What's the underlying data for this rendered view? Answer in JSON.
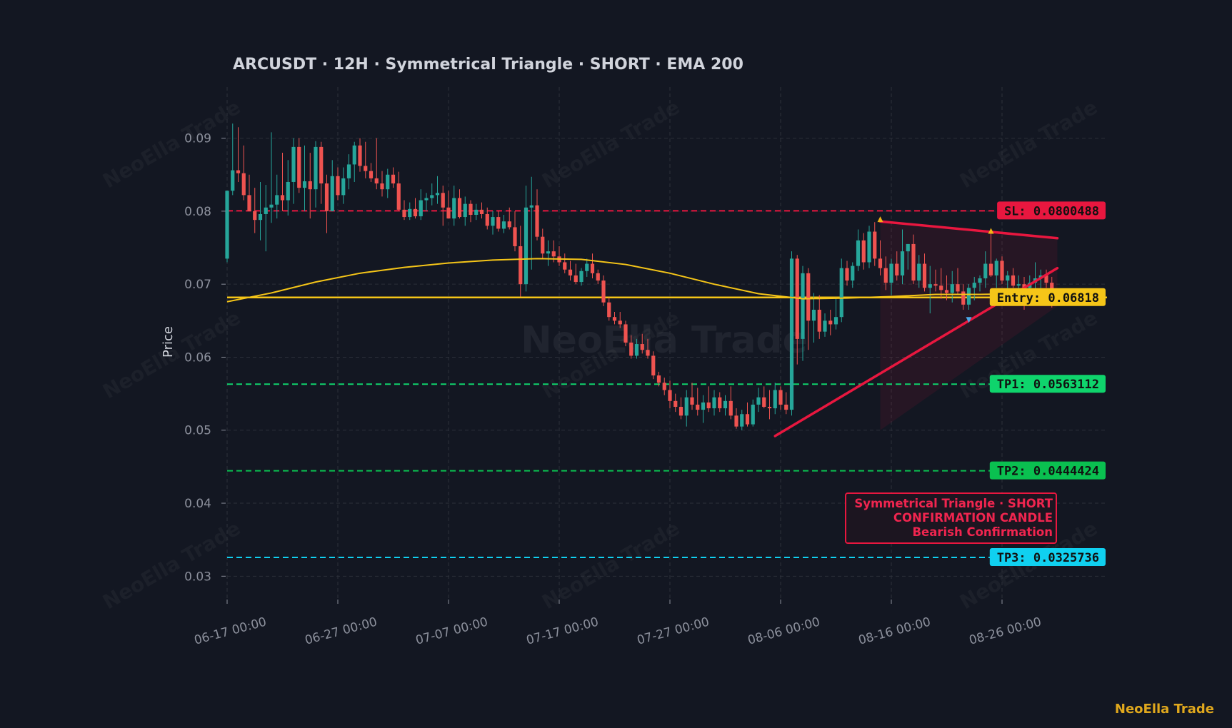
{
  "chart_data": {
    "type": "candlestick",
    "title": "ARCUSDT  ·  12H  ·  Symmetrical Triangle  ·  SHORT  ·  EMA 200",
    "ylabel": "Price",
    "xlabel": "",
    "ylim": [
      0.027,
      0.097
    ],
    "yticks": [
      "0.03",
      "0.04",
      "0.05",
      "0.06",
      "0.07",
      "0.08",
      "0.09"
    ],
    "ytick_values": [
      0.03,
      0.04,
      0.05,
      0.06,
      0.07,
      0.08,
      0.09
    ],
    "xticks": [
      "06-17 00:00",
      "06-27 00:00",
      "07-07 00:00",
      "07-17 00:00",
      "07-27 00:00",
      "08-06 00:00",
      "08-16 00:00",
      "08-26 00:00"
    ],
    "grid": true,
    "colors": {
      "up": "#26a69a",
      "down": "#ef5350",
      "ema": "#f5c518",
      "sl": "#e8173f",
      "entry": "#f5c518",
      "tp1": "#0fd46c",
      "tp2": "#0ac050",
      "tp3": "#10d0f0",
      "background": "#131722"
    },
    "ohlc": [
      {
        "o": 0.0735,
        "h": 0.0828,
        "l": 0.073,
        "c": 0.0828
      },
      {
        "o": 0.0828,
        "h": 0.092,
        "l": 0.0822,
        "c": 0.0856
      },
      {
        "o": 0.0856,
        "h": 0.0915,
        "l": 0.084,
        "c": 0.0852
      },
      {
        "o": 0.0852,
        "h": 0.089,
        "l": 0.0815,
        "c": 0.0822
      },
      {
        "o": 0.0822,
        "h": 0.085,
        "l": 0.08,
        "c": 0.08
      },
      {
        "o": 0.08,
        "h": 0.0832,
        "l": 0.077,
        "c": 0.0788
      },
      {
        "o": 0.0788,
        "h": 0.084,
        "l": 0.076,
        "c": 0.0796
      },
      {
        "o": 0.0796,
        "h": 0.0836,
        "l": 0.0745,
        "c": 0.0805
      },
      {
        "o": 0.0805,
        "h": 0.0908,
        "l": 0.0784,
        "c": 0.0809
      },
      {
        "o": 0.0809,
        "h": 0.085,
        "l": 0.079,
        "c": 0.0822
      },
      {
        "o": 0.0822,
        "h": 0.088,
        "l": 0.08,
        "c": 0.0815
      },
      {
        "o": 0.0815,
        "h": 0.087,
        "l": 0.0794,
        "c": 0.084
      },
      {
        "o": 0.084,
        "h": 0.09,
        "l": 0.081,
        "c": 0.0888
      },
      {
        "o": 0.0888,
        "h": 0.09,
        "l": 0.0825,
        "c": 0.0832
      },
      {
        "o": 0.0832,
        "h": 0.089,
        "l": 0.08,
        "c": 0.0841
      },
      {
        "o": 0.0841,
        "h": 0.088,
        "l": 0.079,
        "c": 0.083
      },
      {
        "o": 0.083,
        "h": 0.0896,
        "l": 0.0805,
        "c": 0.0888
      },
      {
        "o": 0.0888,
        "h": 0.0895,
        "l": 0.081,
        "c": 0.0838
      },
      {
        "o": 0.0838,
        "h": 0.085,
        "l": 0.077,
        "c": 0.08
      },
      {
        "o": 0.08,
        "h": 0.087,
        "l": 0.08,
        "c": 0.0848
      },
      {
        "o": 0.0848,
        "h": 0.086,
        "l": 0.0815,
        "c": 0.0822
      },
      {
        "o": 0.0822,
        "h": 0.086,
        "l": 0.081,
        "c": 0.0845
      },
      {
        "o": 0.0845,
        "h": 0.0878,
        "l": 0.083,
        "c": 0.0864
      },
      {
        "o": 0.0864,
        "h": 0.0895,
        "l": 0.084,
        "c": 0.089
      },
      {
        "o": 0.089,
        "h": 0.09,
        "l": 0.0854,
        "c": 0.0862
      },
      {
        "o": 0.0862,
        "h": 0.0895,
        "l": 0.0845,
        "c": 0.0855
      },
      {
        "o": 0.0855,
        "h": 0.0866,
        "l": 0.084,
        "c": 0.0845
      },
      {
        "o": 0.0845,
        "h": 0.09,
        "l": 0.083,
        "c": 0.0838
      },
      {
        "o": 0.0838,
        "h": 0.0855,
        "l": 0.082,
        "c": 0.083
      },
      {
        "o": 0.083,
        "h": 0.0858,
        "l": 0.0818,
        "c": 0.085
      },
      {
        "o": 0.085,
        "h": 0.086,
        "l": 0.0832,
        "c": 0.0838
      },
      {
        "o": 0.0838,
        "h": 0.0854,
        "l": 0.08,
        "c": 0.0802
      },
      {
        "o": 0.0802,
        "h": 0.0815,
        "l": 0.0788,
        "c": 0.0792
      },
      {
        "o": 0.0792,
        "h": 0.0812,
        "l": 0.0788,
        "c": 0.0803
      },
      {
        "o": 0.0803,
        "h": 0.0818,
        "l": 0.079,
        "c": 0.0793
      },
      {
        "o": 0.0793,
        "h": 0.083,
        "l": 0.0788,
        "c": 0.0815
      },
      {
        "o": 0.0815,
        "h": 0.0825,
        "l": 0.08,
        "c": 0.0818
      },
      {
        "o": 0.0818,
        "h": 0.0838,
        "l": 0.0808,
        "c": 0.0822
      },
      {
        "o": 0.0822,
        "h": 0.0848,
        "l": 0.081,
        "c": 0.0825
      },
      {
        "o": 0.0825,
        "h": 0.0835,
        "l": 0.078,
        "c": 0.0805
      },
      {
        "o": 0.0805,
        "h": 0.0828,
        "l": 0.079,
        "c": 0.079
      },
      {
        "o": 0.079,
        "h": 0.0835,
        "l": 0.078,
        "c": 0.0818
      },
      {
        "o": 0.0818,
        "h": 0.083,
        "l": 0.079,
        "c": 0.0792
      },
      {
        "o": 0.0792,
        "h": 0.082,
        "l": 0.078,
        "c": 0.081
      },
      {
        "o": 0.081,
        "h": 0.0815,
        "l": 0.0785,
        "c": 0.0795
      },
      {
        "o": 0.0795,
        "h": 0.081,
        "l": 0.0788,
        "c": 0.0802
      },
      {
        "o": 0.0802,
        "h": 0.0812,
        "l": 0.079,
        "c": 0.0796
      },
      {
        "o": 0.0796,
        "h": 0.0805,
        "l": 0.0775,
        "c": 0.078
      },
      {
        "o": 0.078,
        "h": 0.08,
        "l": 0.0768,
        "c": 0.0792
      },
      {
        "o": 0.0792,
        "h": 0.08,
        "l": 0.0772,
        "c": 0.0776
      },
      {
        "o": 0.0776,
        "h": 0.0795,
        "l": 0.077,
        "c": 0.0786
      },
      {
        "o": 0.0786,
        "h": 0.0805,
        "l": 0.0775,
        "c": 0.0778
      },
      {
        "o": 0.0778,
        "h": 0.08,
        "l": 0.0745,
        "c": 0.0752
      },
      {
        "o": 0.0752,
        "h": 0.078,
        "l": 0.0683,
        "c": 0.07
      },
      {
        "o": 0.07,
        "h": 0.0835,
        "l": 0.069,
        "c": 0.0805
      },
      {
        "o": 0.0805,
        "h": 0.0847,
        "l": 0.072,
        "c": 0.0808
      },
      {
        "o": 0.0808,
        "h": 0.083,
        "l": 0.076,
        "c": 0.0765
      },
      {
        "o": 0.0765,
        "h": 0.0776,
        "l": 0.0735,
        "c": 0.0742
      },
      {
        "o": 0.0742,
        "h": 0.076,
        "l": 0.0725,
        "c": 0.0745
      },
      {
        "o": 0.0745,
        "h": 0.076,
        "l": 0.073,
        "c": 0.0738
      },
      {
        "o": 0.0738,
        "h": 0.0752,
        "l": 0.0725,
        "c": 0.073
      },
      {
        "o": 0.073,
        "h": 0.0742,
        "l": 0.0715,
        "c": 0.072
      },
      {
        "o": 0.072,
        "h": 0.0732,
        "l": 0.0705,
        "c": 0.0712
      },
      {
        "o": 0.0712,
        "h": 0.0728,
        "l": 0.07,
        "c": 0.0703
      },
      {
        "o": 0.0703,
        "h": 0.0722,
        "l": 0.0698,
        "c": 0.0718
      },
      {
        "o": 0.0718,
        "h": 0.0735,
        "l": 0.071,
        "c": 0.0728
      },
      {
        "o": 0.0728,
        "h": 0.0742,
        "l": 0.0708,
        "c": 0.0715
      },
      {
        "o": 0.0715,
        "h": 0.072,
        "l": 0.07,
        "c": 0.0705
      },
      {
        "o": 0.0705,
        "h": 0.0712,
        "l": 0.067,
        "c": 0.0675
      },
      {
        "o": 0.0675,
        "h": 0.0682,
        "l": 0.065,
        "c": 0.0655
      },
      {
        "o": 0.0655,
        "h": 0.0662,
        "l": 0.0645,
        "c": 0.065
      },
      {
        "o": 0.065,
        "h": 0.0662,
        "l": 0.064,
        "c": 0.0645
      },
      {
        "o": 0.0645,
        "h": 0.065,
        "l": 0.0615,
        "c": 0.062
      },
      {
        "o": 0.062,
        "h": 0.063,
        "l": 0.0598,
        "c": 0.0602
      },
      {
        "o": 0.0602,
        "h": 0.0625,
        "l": 0.0598,
        "c": 0.0618
      },
      {
        "o": 0.0618,
        "h": 0.0632,
        "l": 0.0605,
        "c": 0.061
      },
      {
        "o": 0.061,
        "h": 0.0625,
        "l": 0.0598,
        "c": 0.0602
      },
      {
        "o": 0.0602,
        "h": 0.0608,
        "l": 0.057,
        "c": 0.0575
      },
      {
        "o": 0.0575,
        "h": 0.058,
        "l": 0.056,
        "c": 0.0565
      },
      {
        "o": 0.0565,
        "h": 0.0572,
        "l": 0.0548,
        "c": 0.0555
      },
      {
        "o": 0.0555,
        "h": 0.0568,
        "l": 0.053,
        "c": 0.054
      },
      {
        "o": 0.054,
        "h": 0.055,
        "l": 0.0525,
        "c": 0.0532
      },
      {
        "o": 0.0532,
        "h": 0.0545,
        "l": 0.0515,
        "c": 0.052
      },
      {
        "o": 0.052,
        "h": 0.0555,
        "l": 0.0505,
        "c": 0.0545
      },
      {
        "o": 0.0545,
        "h": 0.0565,
        "l": 0.0528,
        "c": 0.0535
      },
      {
        "o": 0.0535,
        "h": 0.0558,
        "l": 0.052,
        "c": 0.0528
      },
      {
        "o": 0.0528,
        "h": 0.0548,
        "l": 0.051,
        "c": 0.0538
      },
      {
        "o": 0.0538,
        "h": 0.056,
        "l": 0.0525,
        "c": 0.053
      },
      {
        "o": 0.053,
        "h": 0.0555,
        "l": 0.052,
        "c": 0.0545
      },
      {
        "o": 0.0545,
        "h": 0.0552,
        "l": 0.0525,
        "c": 0.053
      },
      {
        "o": 0.053,
        "h": 0.0548,
        "l": 0.052,
        "c": 0.054
      },
      {
        "o": 0.054,
        "h": 0.056,
        "l": 0.0515,
        "c": 0.052
      },
      {
        "o": 0.052,
        "h": 0.053,
        "l": 0.0502,
        "c": 0.0505
      },
      {
        "o": 0.0505,
        "h": 0.0528,
        "l": 0.05,
        "c": 0.0522
      },
      {
        "o": 0.0522,
        "h": 0.0538,
        "l": 0.0505,
        "c": 0.0508
      },
      {
        "o": 0.0508,
        "h": 0.0542,
        "l": 0.0505,
        "c": 0.0535
      },
      {
        "o": 0.0535,
        "h": 0.0558,
        "l": 0.0525,
        "c": 0.0545
      },
      {
        "o": 0.0545,
        "h": 0.056,
        "l": 0.053,
        "c": 0.0532
      },
      {
        "o": 0.0532,
        "h": 0.0555,
        "l": 0.0515,
        "c": 0.053
      },
      {
        "o": 0.053,
        "h": 0.0565,
        "l": 0.0522,
        "c": 0.0555
      },
      {
        "o": 0.0555,
        "h": 0.056,
        "l": 0.0528,
        "c": 0.0535
      },
      {
        "o": 0.0535,
        "h": 0.0552,
        "l": 0.0522,
        "c": 0.0528
      },
      {
        "o": 0.0528,
        "h": 0.0745,
        "l": 0.052,
        "c": 0.0735
      },
      {
        "o": 0.0735,
        "h": 0.074,
        "l": 0.059,
        "c": 0.0625
      },
      {
        "o": 0.0625,
        "h": 0.0725,
        "l": 0.0595,
        "c": 0.0715
      },
      {
        "o": 0.0715,
        "h": 0.0722,
        "l": 0.061,
        "c": 0.065
      },
      {
        "o": 0.065,
        "h": 0.0688,
        "l": 0.062,
        "c": 0.0665
      },
      {
        "o": 0.0665,
        "h": 0.0685,
        "l": 0.0625,
        "c": 0.0635
      },
      {
        "o": 0.0635,
        "h": 0.066,
        "l": 0.0628,
        "c": 0.065
      },
      {
        "o": 0.065,
        "h": 0.0665,
        "l": 0.063,
        "c": 0.0645
      },
      {
        "o": 0.0645,
        "h": 0.0682,
        "l": 0.0638,
        "c": 0.0655
      },
      {
        "o": 0.0655,
        "h": 0.0735,
        "l": 0.0648,
        "c": 0.0722
      },
      {
        "o": 0.0722,
        "h": 0.0732,
        "l": 0.0698,
        "c": 0.0705
      },
      {
        "o": 0.0705,
        "h": 0.073,
        "l": 0.0695,
        "c": 0.0725
      },
      {
        "o": 0.0725,
        "h": 0.0775,
        "l": 0.0718,
        "c": 0.076
      },
      {
        "o": 0.076,
        "h": 0.077,
        "l": 0.072,
        "c": 0.073
      },
      {
        "o": 0.073,
        "h": 0.078,
        "l": 0.0722,
        "c": 0.0772
      },
      {
        "o": 0.0772,
        "h": 0.0785,
        "l": 0.0725,
        "c": 0.0735
      },
      {
        "o": 0.0735,
        "h": 0.076,
        "l": 0.0712,
        "c": 0.0722
      },
      {
        "o": 0.0722,
        "h": 0.0738,
        "l": 0.0692,
        "c": 0.0702
      },
      {
        "o": 0.0702,
        "h": 0.0735,
        "l": 0.0685,
        "c": 0.0728
      },
      {
        "o": 0.0728,
        "h": 0.0745,
        "l": 0.0705,
        "c": 0.0712
      },
      {
        "o": 0.0712,
        "h": 0.0775,
        "l": 0.07,
        "c": 0.0745
      },
      {
        "o": 0.0745,
        "h": 0.0755,
        "l": 0.072,
        "c": 0.0755
      },
      {
        "o": 0.0755,
        "h": 0.0768,
        "l": 0.07,
        "c": 0.0705
      },
      {
        "o": 0.0705,
        "h": 0.074,
        "l": 0.0695,
        "c": 0.0728
      },
      {
        "o": 0.0728,
        "h": 0.0742,
        "l": 0.069,
        "c": 0.0695
      },
      {
        "o": 0.0695,
        "h": 0.0725,
        "l": 0.066,
        "c": 0.07
      },
      {
        "o": 0.07,
        "h": 0.072,
        "l": 0.069,
        "c": 0.0698
      },
      {
        "o": 0.0698,
        "h": 0.0722,
        "l": 0.068,
        "c": 0.0692
      },
      {
        "o": 0.0692,
        "h": 0.0712,
        "l": 0.0678,
        "c": 0.0688
      },
      {
        "o": 0.0688,
        "h": 0.0718,
        "l": 0.0675,
        "c": 0.07
      },
      {
        "o": 0.07,
        "h": 0.0722,
        "l": 0.0685,
        "c": 0.069
      },
      {
        "o": 0.069,
        "h": 0.07,
        "l": 0.0665,
        "c": 0.0672
      },
      {
        "o": 0.0672,
        "h": 0.07,
        "l": 0.0665,
        "c": 0.0695
      },
      {
        "o": 0.0695,
        "h": 0.071,
        "l": 0.0678,
        "c": 0.0702
      },
      {
        "o": 0.0702,
        "h": 0.0712,
        "l": 0.069,
        "c": 0.0708
      },
      {
        "o": 0.0708,
        "h": 0.0745,
        "l": 0.0695,
        "c": 0.0728
      },
      {
        "o": 0.0728,
        "h": 0.077,
        "l": 0.071,
        "c": 0.0712
      },
      {
        "o": 0.0712,
        "h": 0.0735,
        "l": 0.0695,
        "c": 0.0732
      },
      {
        "o": 0.0732,
        "h": 0.0738,
        "l": 0.07,
        "c": 0.0705
      },
      {
        "o": 0.0705,
        "h": 0.0718,
        "l": 0.069,
        "c": 0.0712
      },
      {
        "o": 0.0712,
        "h": 0.0722,
        "l": 0.0695,
        "c": 0.0698
      },
      {
        "o": 0.0698,
        "h": 0.0712,
        "l": 0.0682,
        "c": 0.07
      },
      {
        "o": 0.07,
        "h": 0.071,
        "l": 0.0665,
        "c": 0.0695
      },
      {
        "o": 0.0695,
        "h": 0.0712,
        "l": 0.0688,
        "c": 0.0702
      },
      {
        "o": 0.0702,
        "h": 0.073,
        "l": 0.069,
        "c": 0.0708
      },
      {
        "o": 0.0708,
        "h": 0.072,
        "l": 0.069,
        "c": 0.0712
      },
      {
        "o": 0.0712,
        "h": 0.072,
        "l": 0.0695,
        "c": 0.0702
      },
      {
        "o": 0.0702,
        "h": 0.071,
        "l": 0.0668,
        "c": 0.0682
      }
    ],
    "ema200": [
      {
        "i": 0,
        "v": 0.0676
      },
      {
        "i": 8,
        "v": 0.0688
      },
      {
        "i": 16,
        "v": 0.0703
      },
      {
        "i": 24,
        "v": 0.0715
      },
      {
        "i": 32,
        "v": 0.0723
      },
      {
        "i": 40,
        "v": 0.0729
      },
      {
        "i": 48,
        "v": 0.0733
      },
      {
        "i": 56,
        "v": 0.0735
      },
      {
        "i": 64,
        "v": 0.0734
      },
      {
        "i": 72,
        "v": 0.0727
      },
      {
        "i": 80,
        "v": 0.0715
      },
      {
        "i": 88,
        "v": 0.07
      },
      {
        "i": 96,
        "v": 0.0687
      },
      {
        "i": 104,
        "v": 0.068
      },
      {
        "i": 112,
        "v": 0.0681
      },
      {
        "i": 120,
        "v": 0.0683
      },
      {
        "i": 128,
        "v": 0.0686
      },
      {
        "i": 136,
        "v": 0.0686
      },
      {
        "i": 144,
        "v": 0.0687
      }
    ],
    "levels": [
      {
        "key": "sl",
        "label": "SL: 0.0800488",
        "value": 0.0800488,
        "color": "#e8173f",
        "text_color": "#111111",
        "style": "dashed"
      },
      {
        "key": "entry",
        "label": "Entry: 0.06818",
        "value": 0.06818,
        "color": "#f5c518",
        "text_color": "#111111",
        "style": "solid"
      },
      {
        "key": "tp1",
        "label": "TP1: 0.0563112",
        "value": 0.0563112,
        "color": "#0fd46c",
        "text_color": "#111111",
        "style": "dashed"
      },
      {
        "key": "tp2",
        "label": "TP2: 0.0444424",
        "value": 0.0444424,
        "color": "#0ac050",
        "text_color": "#111111",
        "style": "dashed"
      },
      {
        "key": "tp3",
        "label": "TP3: 0.0325736",
        "value": 0.0325736,
        "color": "#10d0f0",
        "text_color": "#111111",
        "style": "dashed"
      }
    ],
    "triangle": {
      "upper": [
        {
          "i": 118,
          "v": 0.0786
        },
        {
          "i": 150,
          "v": 0.0763
        }
      ],
      "lower": [
        {
          "i": 99,
          "v": 0.0492
        },
        {
          "i": 150,
          "v": 0.0722
        }
      ],
      "zone_start_i": 118,
      "zone_end_i": 150,
      "zone_bottom_start": 0.05,
      "zone_bottom_end": 0.067
    },
    "markers": [
      {
        "type": "peak",
        "i": 118,
        "v": 0.0788,
        "color": "#f2b415"
      },
      {
        "type": "peak",
        "i": 138,
        "v": 0.0772,
        "color": "#f2b415"
      },
      {
        "type": "trough",
        "i": 134,
        "v": 0.0652,
        "color": "#4aa8e8"
      }
    ],
    "annotation": [
      "Symmetrical Triangle · SHORT",
      "CONFIRMATION CANDLE",
      "Bearish Confirmation"
    ],
    "watermark": "NeoElla Trade",
    "brand": "NeoElla Trade"
  }
}
